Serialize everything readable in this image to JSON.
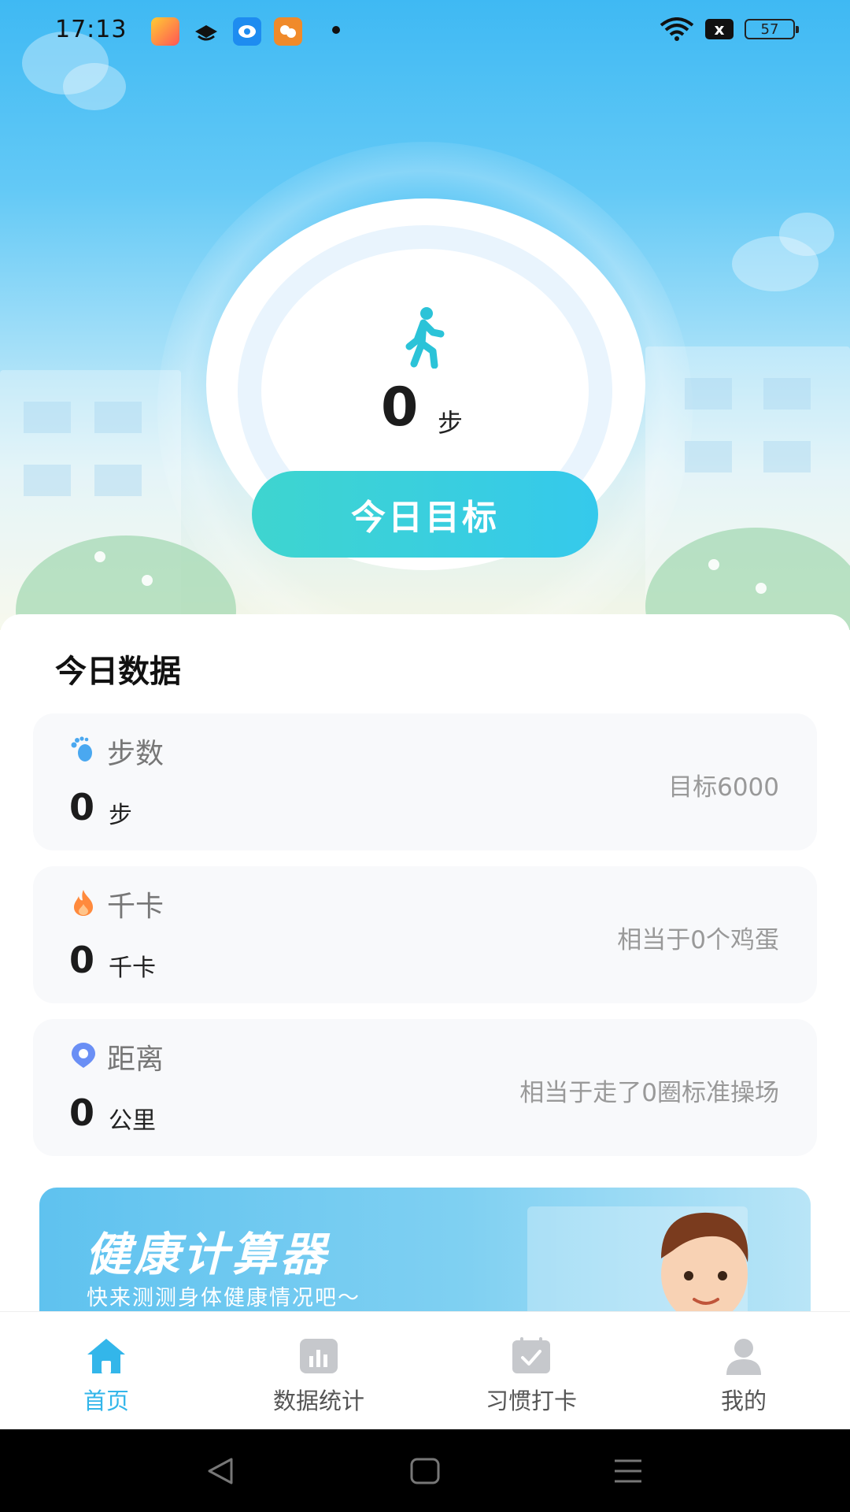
{
  "status_bar": {
    "time": "17:13",
    "battery": "57",
    "network_badge": "x"
  },
  "hero": {
    "step_count": "0",
    "step_unit": "步",
    "goal_button_label": "今日目标"
  },
  "today": {
    "section_title": "今日数据",
    "cards": [
      {
        "icon": "footprint-icon",
        "label": "步数",
        "value": "0",
        "unit": "步",
        "note": "目标6000",
        "icon_color": "#4aa8f0"
      },
      {
        "icon": "flame-icon",
        "label": "千卡",
        "value": "0",
        "unit": "千卡",
        "note": "相当于0个鸡蛋",
        "icon_color": "#ff8a3d"
      },
      {
        "icon": "location-pin-icon",
        "label": "距离",
        "value": "0",
        "unit": "公里",
        "note": "相当于走了0圈标准操场",
        "icon_color": "#6a8ff5"
      }
    ]
  },
  "banner": {
    "title": "健康计算器",
    "subtitle": "快来测测身体健康情况吧～"
  },
  "tabs": [
    {
      "label": "首页",
      "icon": "home-icon",
      "active": true
    },
    {
      "label": "数据统计",
      "icon": "bar-chart-icon",
      "active": false
    },
    {
      "label": "习惯打卡",
      "icon": "checkin-icon",
      "active": false
    },
    {
      "label": "我的",
      "icon": "profile-icon",
      "active": false
    }
  ],
  "colors": {
    "accent": "#33b6ea",
    "goal_button_start": "#3ed5cf",
    "goal_button_end": "#35c9ec",
    "card_bg": "#f8f9fb"
  }
}
